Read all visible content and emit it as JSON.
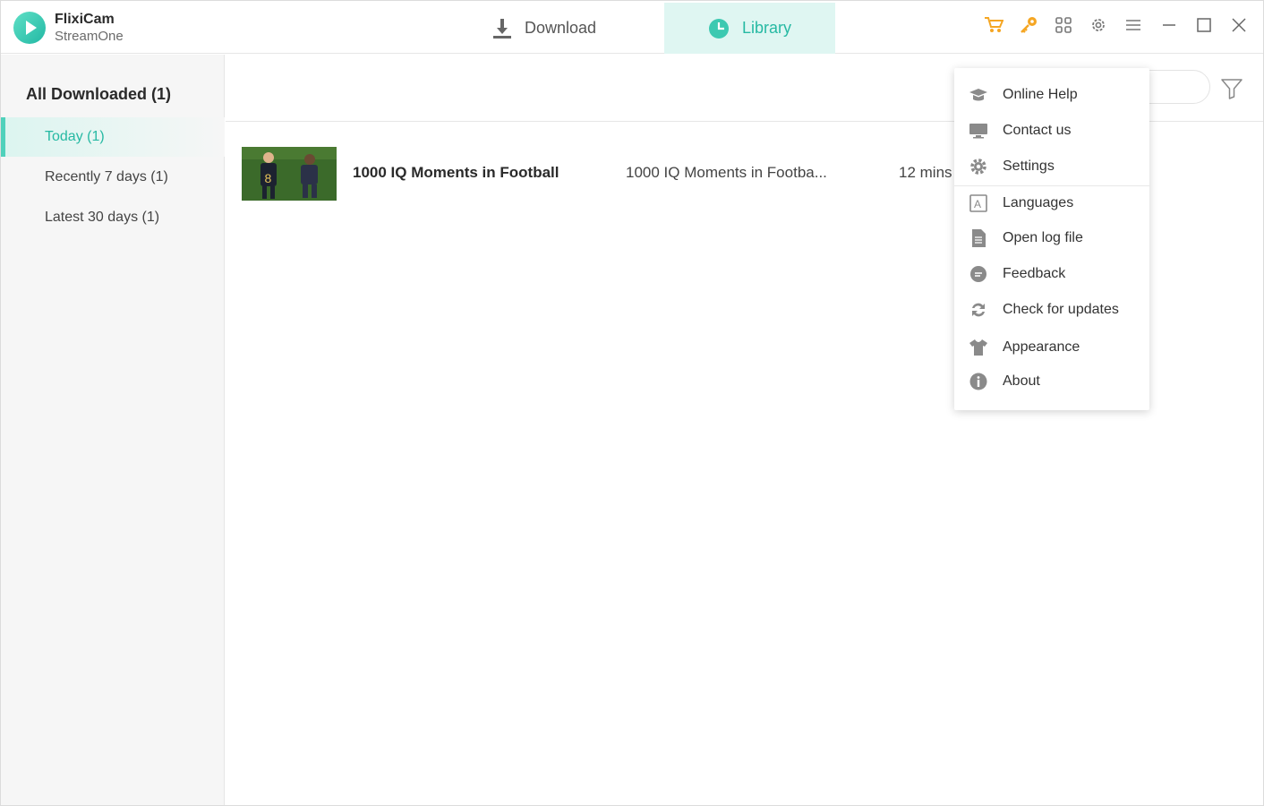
{
  "app": {
    "name": "FlixiCam",
    "subtitle": "StreamOne"
  },
  "tabs": [
    {
      "label": "Download",
      "icon": "download-icon",
      "active": false
    },
    {
      "label": "Library",
      "icon": "clock-icon",
      "active": true
    }
  ],
  "toolbar_icons": [
    "cart-icon",
    "key-icon",
    "apps-grid-icon",
    "gear-icon",
    "menu-icon",
    "minimize-icon",
    "maximize-icon",
    "close-icon"
  ],
  "colors": {
    "accent": "#26b9a3",
    "accent_light": "#dff6f2",
    "orange": "#f5a623"
  },
  "sidebar": {
    "heading": "All Downloaded (1)",
    "items": [
      {
        "label": "Today (1)",
        "active": true
      },
      {
        "label": "Recently 7 days (1)",
        "active": false
      },
      {
        "label": "Latest 30 days (1)",
        "active": false
      }
    ]
  },
  "library": {
    "rows": [
      {
        "title": "1000 IQ Moments in Football",
        "subtitle": "1000 IQ Moments in Footba...",
        "duration": "12 mins"
      }
    ]
  },
  "menu": {
    "items": [
      {
        "label": "Online Help",
        "icon": "graduation-cap-icon"
      },
      {
        "label": "Contact us",
        "icon": "monitor-icon"
      },
      {
        "label": "Settings",
        "icon": "gear-icon"
      },
      {
        "label": "Languages",
        "icon": "language-icon"
      },
      {
        "label": "Open log file",
        "icon": "document-icon"
      },
      {
        "label": "Feedback",
        "icon": "chat-bubble-icon"
      },
      {
        "label": "Check for updates",
        "icon": "refresh-icon"
      },
      {
        "label": "Appearance",
        "icon": "tshirt-icon"
      },
      {
        "label": "About",
        "icon": "info-icon"
      }
    ]
  }
}
